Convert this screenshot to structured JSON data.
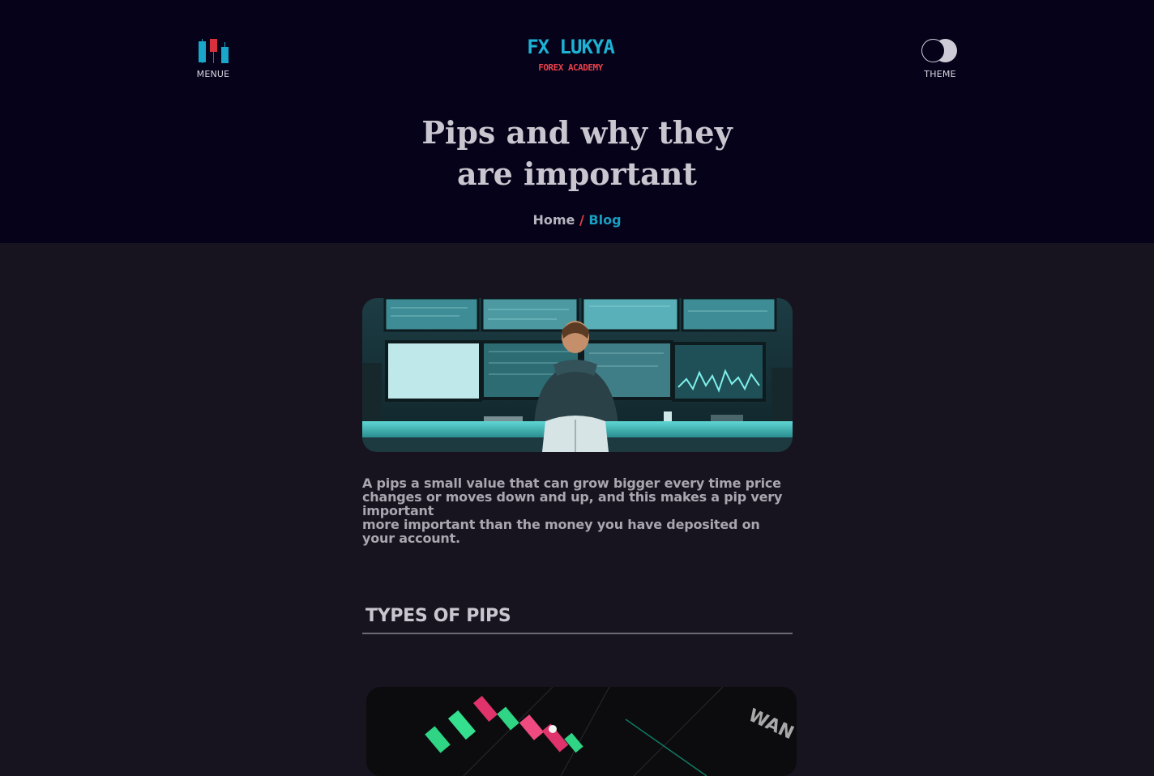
{
  "header": {
    "menu_label": "MENUE",
    "theme_label": "THEME",
    "logo_name": "FX LUKYA",
    "logo_sub": "FOREX ACADEMY",
    "title_line1": "Pips and why they",
    "title_line2": "are important"
  },
  "breadcrumb": {
    "home": "Home",
    "separator": "/",
    "current": "Blog"
  },
  "article": {
    "paragraph_1": "A pips a small value that can grow bigger every time price changes or moves down and up, and this makes a pip very important",
    "paragraph_2": "more important than the money you have deposited on your account.",
    "section_title": "TYPES OF PIPS"
  },
  "colors": {
    "header_bg": "#05021a",
    "page_bg": "#18141f",
    "brand_blue": "#1cb3d4",
    "brand_red": "#e84149"
  },
  "icons": {
    "menu": "candlestick-menu-icon",
    "theme": "theme-toggle-icon"
  }
}
